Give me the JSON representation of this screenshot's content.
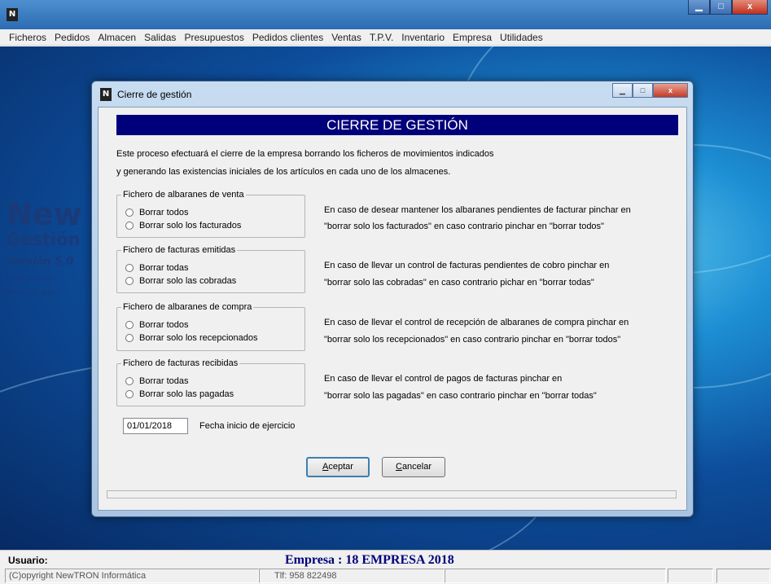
{
  "window": {
    "app_icon": "N",
    "controls": {
      "minimize": "▁",
      "maximize": "□",
      "close": "x"
    }
  },
  "menu": {
    "items": [
      "Ficheros",
      "Pedidos",
      "Almacen",
      "Salidas",
      "Presupuestos",
      "Pedidos clientes",
      "Ventas",
      "T.P.V.",
      "Inventario",
      "Empresa",
      "Utilidades"
    ]
  },
  "background": {
    "brand_new": "New",
    "brand_gestion": "Gestión",
    "version": "Versión 5.0",
    "compilacion": "Compilación",
    "base_datos": "Base de dato"
  },
  "dialog": {
    "title": "Cierre de gestión",
    "icon": "N",
    "banner": "CIERRE DE GESTIÓN",
    "intro_line1": "Este proceso efectuará el cierre de la empresa borrando los ficheros de movimientos indicados",
    "intro_line2": "y generando las existencias iniciales de los artículos en cada uno de los almacenes.",
    "groups": [
      {
        "legend": "Fichero de albaranes de venta",
        "options": [
          "Borrar todos",
          "Borrar solo los facturados"
        ],
        "desc1": "En caso de desear mantener los albaranes pendientes de facturar pinchar en",
        "desc2": "\"borrar solo los facturados\" en caso contrario pinchar en \"borrar todos\""
      },
      {
        "legend": "Fichero de facturas emitidas",
        "options": [
          "Borrar todas",
          "Borrar solo las cobradas"
        ],
        "desc1": "En caso de llevar un control de facturas pendientes de cobro pinchar en",
        "desc2": "\"borrar solo las cobradas\" en caso contrario pichar en \"borrar todas\""
      },
      {
        "legend": "Fichero de albaranes de compra",
        "options": [
          "Borrar todos",
          "Borrar solo los recepcionados"
        ],
        "desc1": "En caso de llevar el control de recepción de albaranes de compra pinchar en",
        "desc2": "\"borrar solo los recepcionados\" en caso contrario pinchar en \"borrar todos\""
      },
      {
        "legend": "Fichero de facturas recibidas",
        "options": [
          "Borrar todas",
          "Borrar solo las pagadas"
        ],
        "desc1": "En caso de llevar el control de pagos de facturas pinchar en",
        "desc2": "\"borrar solo las pagadas\" en caso contrario pinchar en \"borrar todas\""
      }
    ],
    "date_value": "01/01/2018",
    "date_label": "Fecha inicio de ejercicio",
    "accept_hotkey": "A",
    "accept_rest": "ceptar",
    "cancel_hotkey": "C",
    "cancel_rest": "ancelar"
  },
  "status": {
    "user_label": "Usuario:",
    "company": "Empresa : 18 EMPRESA 2018",
    "copyright": "(C)opyright NewTRON Informática",
    "phone": "Tlf: 958 822498"
  }
}
